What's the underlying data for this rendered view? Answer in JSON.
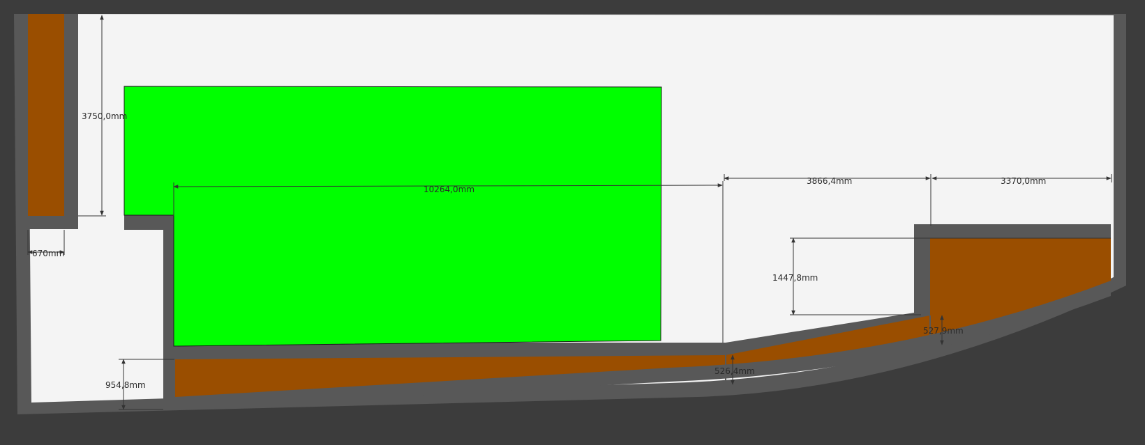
{
  "colors": {
    "background": "#3c3c3c",
    "interior": "#f4f4f4",
    "wall": "#585858",
    "tank": "#9a4e00",
    "highlight": "#00ff00",
    "dimension": "#333333"
  },
  "dimensions": {
    "d3750": "3750,0mm",
    "d670": "670mm",
    "d10264": "10264,0mm",
    "d3866": "3866,4mm",
    "d3370": "3370,0mm",
    "d1447": "1447,8mm",
    "d527": "527,9mm",
    "d526": "526,4mm",
    "d954": "954,8mm"
  }
}
